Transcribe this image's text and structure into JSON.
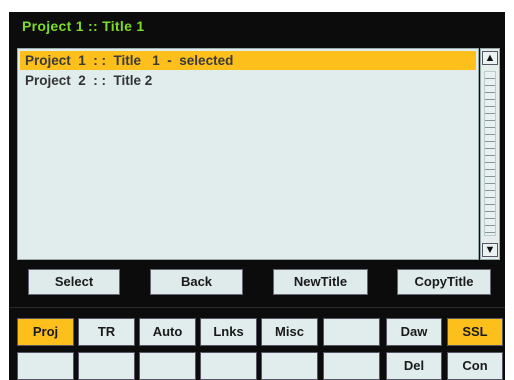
{
  "title": "Project  1  ::  Title  1",
  "list": {
    "items": [
      {
        "label": "Project  1  : :  Title   1  -  selected",
        "selected": true
      },
      {
        "label": "Project  2  : :  Title 2",
        "selected": false
      }
    ]
  },
  "scrollbar": {
    "up_glyph": "▲",
    "down_glyph": "▼"
  },
  "actions": {
    "select": "Select",
    "back": "Back",
    "new_title": "NewTitle",
    "copy_title": "CopyTitle"
  },
  "tabs_row1": [
    "Proj",
    "TR",
    "Auto",
    "Lnks",
    "Misc",
    "",
    "Daw",
    "SSL"
  ],
  "tabs_row2": [
    "",
    "",
    "",
    "",
    "",
    "",
    "Del",
    "Con"
  ],
  "colors": {
    "accent": "#fcbf1b",
    "title_green": "#7cdc2a",
    "panel": "#0c0c0c",
    "list_bg": "#e1ecec"
  }
}
